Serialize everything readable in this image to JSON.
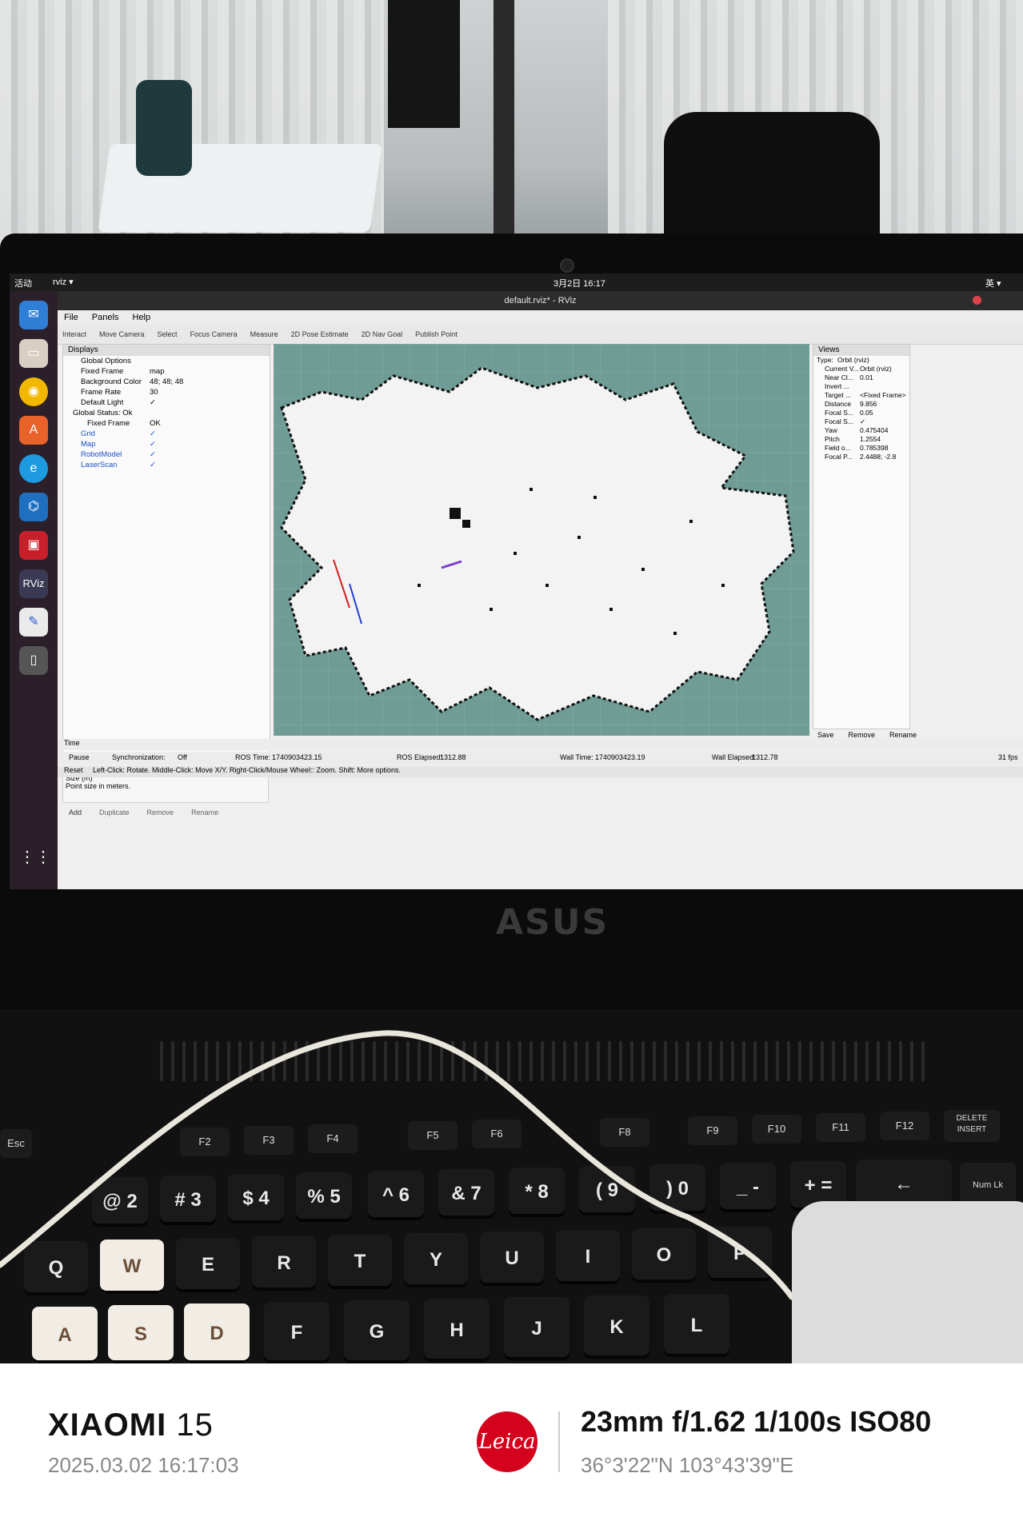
{
  "topbar": {
    "activities": "活动",
    "app": "rviz ▾",
    "clock": "3月2日 16:17",
    "lang": "英 ▾"
  },
  "window": {
    "title": "default.rviz* - RViz",
    "menu": [
      "File",
      "Panels",
      "Help"
    ],
    "toolbar": [
      "Interact",
      "Move Camera",
      "Select",
      "Focus Camera",
      "Measure",
      "2D Pose Estimate",
      "2D Nav Goal",
      "Publish Point"
    ]
  },
  "displays": {
    "header": "Displays",
    "global_options": "Global Options",
    "fixed_frame_label": "Fixed Frame",
    "fixed_frame_value": "map",
    "bg_color_label": "Background Color",
    "bg_color_value": "48; 48; 48",
    "frame_rate_label": "Frame Rate",
    "frame_rate_value": "30",
    "default_light_label": "Default Light",
    "default_light_value": "✓",
    "global_status_label": "Global Status: Ok",
    "status_fixed_frame_label": "Fixed Frame",
    "status_fixed_frame_value": "OK",
    "items": [
      "Grid",
      "Map",
      "RobotModel",
      "LaserScan"
    ],
    "desc_title": "Size (m)",
    "desc_text": "Point size in meters.",
    "buttons": [
      "Add",
      "Duplicate",
      "Remove",
      "Rename"
    ]
  },
  "views": {
    "header": "Views",
    "type_label": "Type:",
    "type_value": "Orbit (rviz)",
    "rows": [
      {
        "k": "Current V...",
        "v": "Orbit (rviz)"
      },
      {
        "k": "Near Cl...",
        "v": "0.01"
      },
      {
        "k": "Invert ...",
        "v": ""
      },
      {
        "k": "Target ...",
        "v": "<Fixed Frame>"
      },
      {
        "k": "Distance",
        "v": "9.856"
      },
      {
        "k": "Focal S...",
        "v": "0.05"
      },
      {
        "k": "Focal S...",
        "v": "✓"
      },
      {
        "k": "Yaw",
        "v": "0.475404"
      },
      {
        "k": "Pitch",
        "v": "1.2554"
      },
      {
        "k": "Field o...",
        "v": "0.785398"
      },
      {
        "k": "Focal P...",
        "v": "2.4488; -2.8"
      }
    ],
    "buttons": [
      "Save",
      "Remove",
      "Rename"
    ]
  },
  "time": {
    "header": "Time",
    "pause": "Pause",
    "sync_label": "Synchronization:",
    "sync_value": "Off",
    "ros_time_label": "ROS Time:",
    "ros_time_value": "1740903423.15",
    "ros_elapsed_label": "ROS Elapsed:",
    "ros_elapsed_value": "1312.88",
    "wall_time_label": "Wall Time:",
    "wall_time_value": "1740903423.19",
    "wall_elapsed_label": "Wall Elapsed:",
    "wall_elapsed_value": "1312.78",
    "fps": "31 fps"
  },
  "statusbar": {
    "reset": "Reset",
    "hint": "Left-Click: Rotate. Middle-Click: Move X/Y. Right-Click/Mouse Wheel:: Zoom. Shift: More options."
  },
  "laptop": {
    "logo": "ASUS"
  },
  "keyboard": {
    "fkeys": [
      "F2",
      "F3",
      "F4",
      "F5",
      "F6",
      "F8",
      "F9",
      "F10",
      "F11",
      "F12",
      "DELETE INSERT"
    ],
    "num_row": [
      "@ 2",
      "# 3",
      "$ 4",
      "% 5",
      "^ 6",
      "& 7",
      "* 8",
      "( 9",
      ") 0",
      "_ -",
      "+ ="
    ],
    "top_row": [
      "Q",
      "W",
      "E",
      "R",
      "T",
      "Y",
      "U",
      "I",
      "O",
      "P"
    ],
    "home_row": [
      "A",
      "S",
      "D",
      "F",
      "G",
      "H",
      "J",
      "K",
      "L"
    ],
    "num_lk": "Num Lk",
    "esc": "Esc"
  },
  "footer": {
    "brand": "XIAOMI",
    "model": "15",
    "datetime": "2025.03.02 16:17:03",
    "leica": "Leica",
    "params": "23mm  f/1.62  1/100s  ISO80",
    "coords": "36°3'22\"N  103°43'39\"E"
  },
  "colors": {
    "map_background": "#6f9c95",
    "leica_red": "#d4021d",
    "dock_background": "#2b1f2a"
  }
}
